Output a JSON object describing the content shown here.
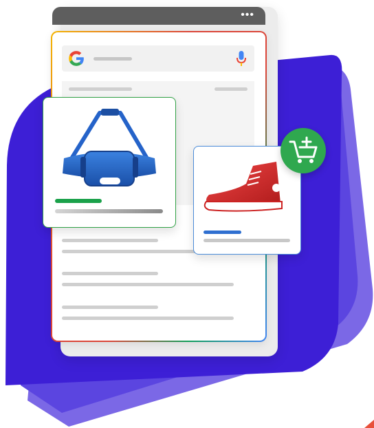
{
  "colors": {
    "purple_dark": "#3d1fd6",
    "purple_light": "#7b68e6",
    "google_blue": "#4285f4",
    "google_red": "#ea4335",
    "google_yellow": "#fbbc05",
    "google_green": "#34a853",
    "cart_green": "#2fa84f",
    "bag_blue": "#1f5fbf",
    "shoe_red": "#d62828"
  },
  "icons": {
    "menu": "more-dots-icon",
    "logo": "google-g-logo",
    "mic": "microphone-icon",
    "cart": "add-to-cart-icon",
    "bag": "duffel-bag-icon",
    "shoe": "high-top-sneaker-icon"
  },
  "topbar": {
    "menu_glyph": "•••"
  }
}
